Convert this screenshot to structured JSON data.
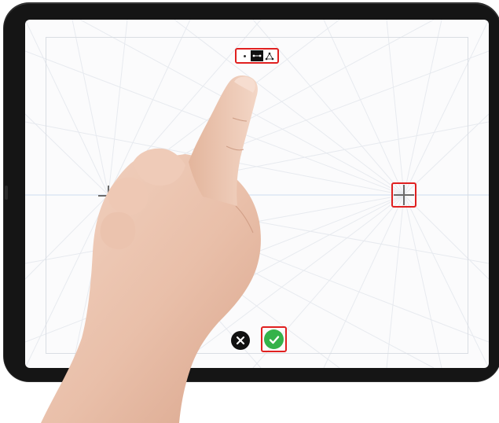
{
  "device": {
    "type": "tablet"
  },
  "canvas": {
    "mode": "perspective-guide",
    "background_color": "#fbfbfc",
    "guide_color": "#e6e9ee",
    "horizon_color": "#d6e2f2"
  },
  "toolbar": {
    "modes": [
      {
        "name": "one-point",
        "icon": "single-dot-icon",
        "active": false
      },
      {
        "name": "two-point",
        "icon": "two-point-icon",
        "active": true
      },
      {
        "name": "three-point",
        "icon": "three-point-icon",
        "active": false
      }
    ]
  },
  "vanishing_points": [
    {
      "name": "left-vanishing-point",
      "icon": "crosshair-icon",
      "highlighted": false
    },
    {
      "name": "right-vanishing-point",
      "icon": "crosshair-icon",
      "highlighted": true
    }
  ],
  "actions": {
    "cancel": {
      "icon": "close-icon",
      "color": "#111111"
    },
    "done": {
      "icon": "checkmark-icon",
      "color": "#34b24a"
    }
  },
  "highlight_color": "#e02020"
}
